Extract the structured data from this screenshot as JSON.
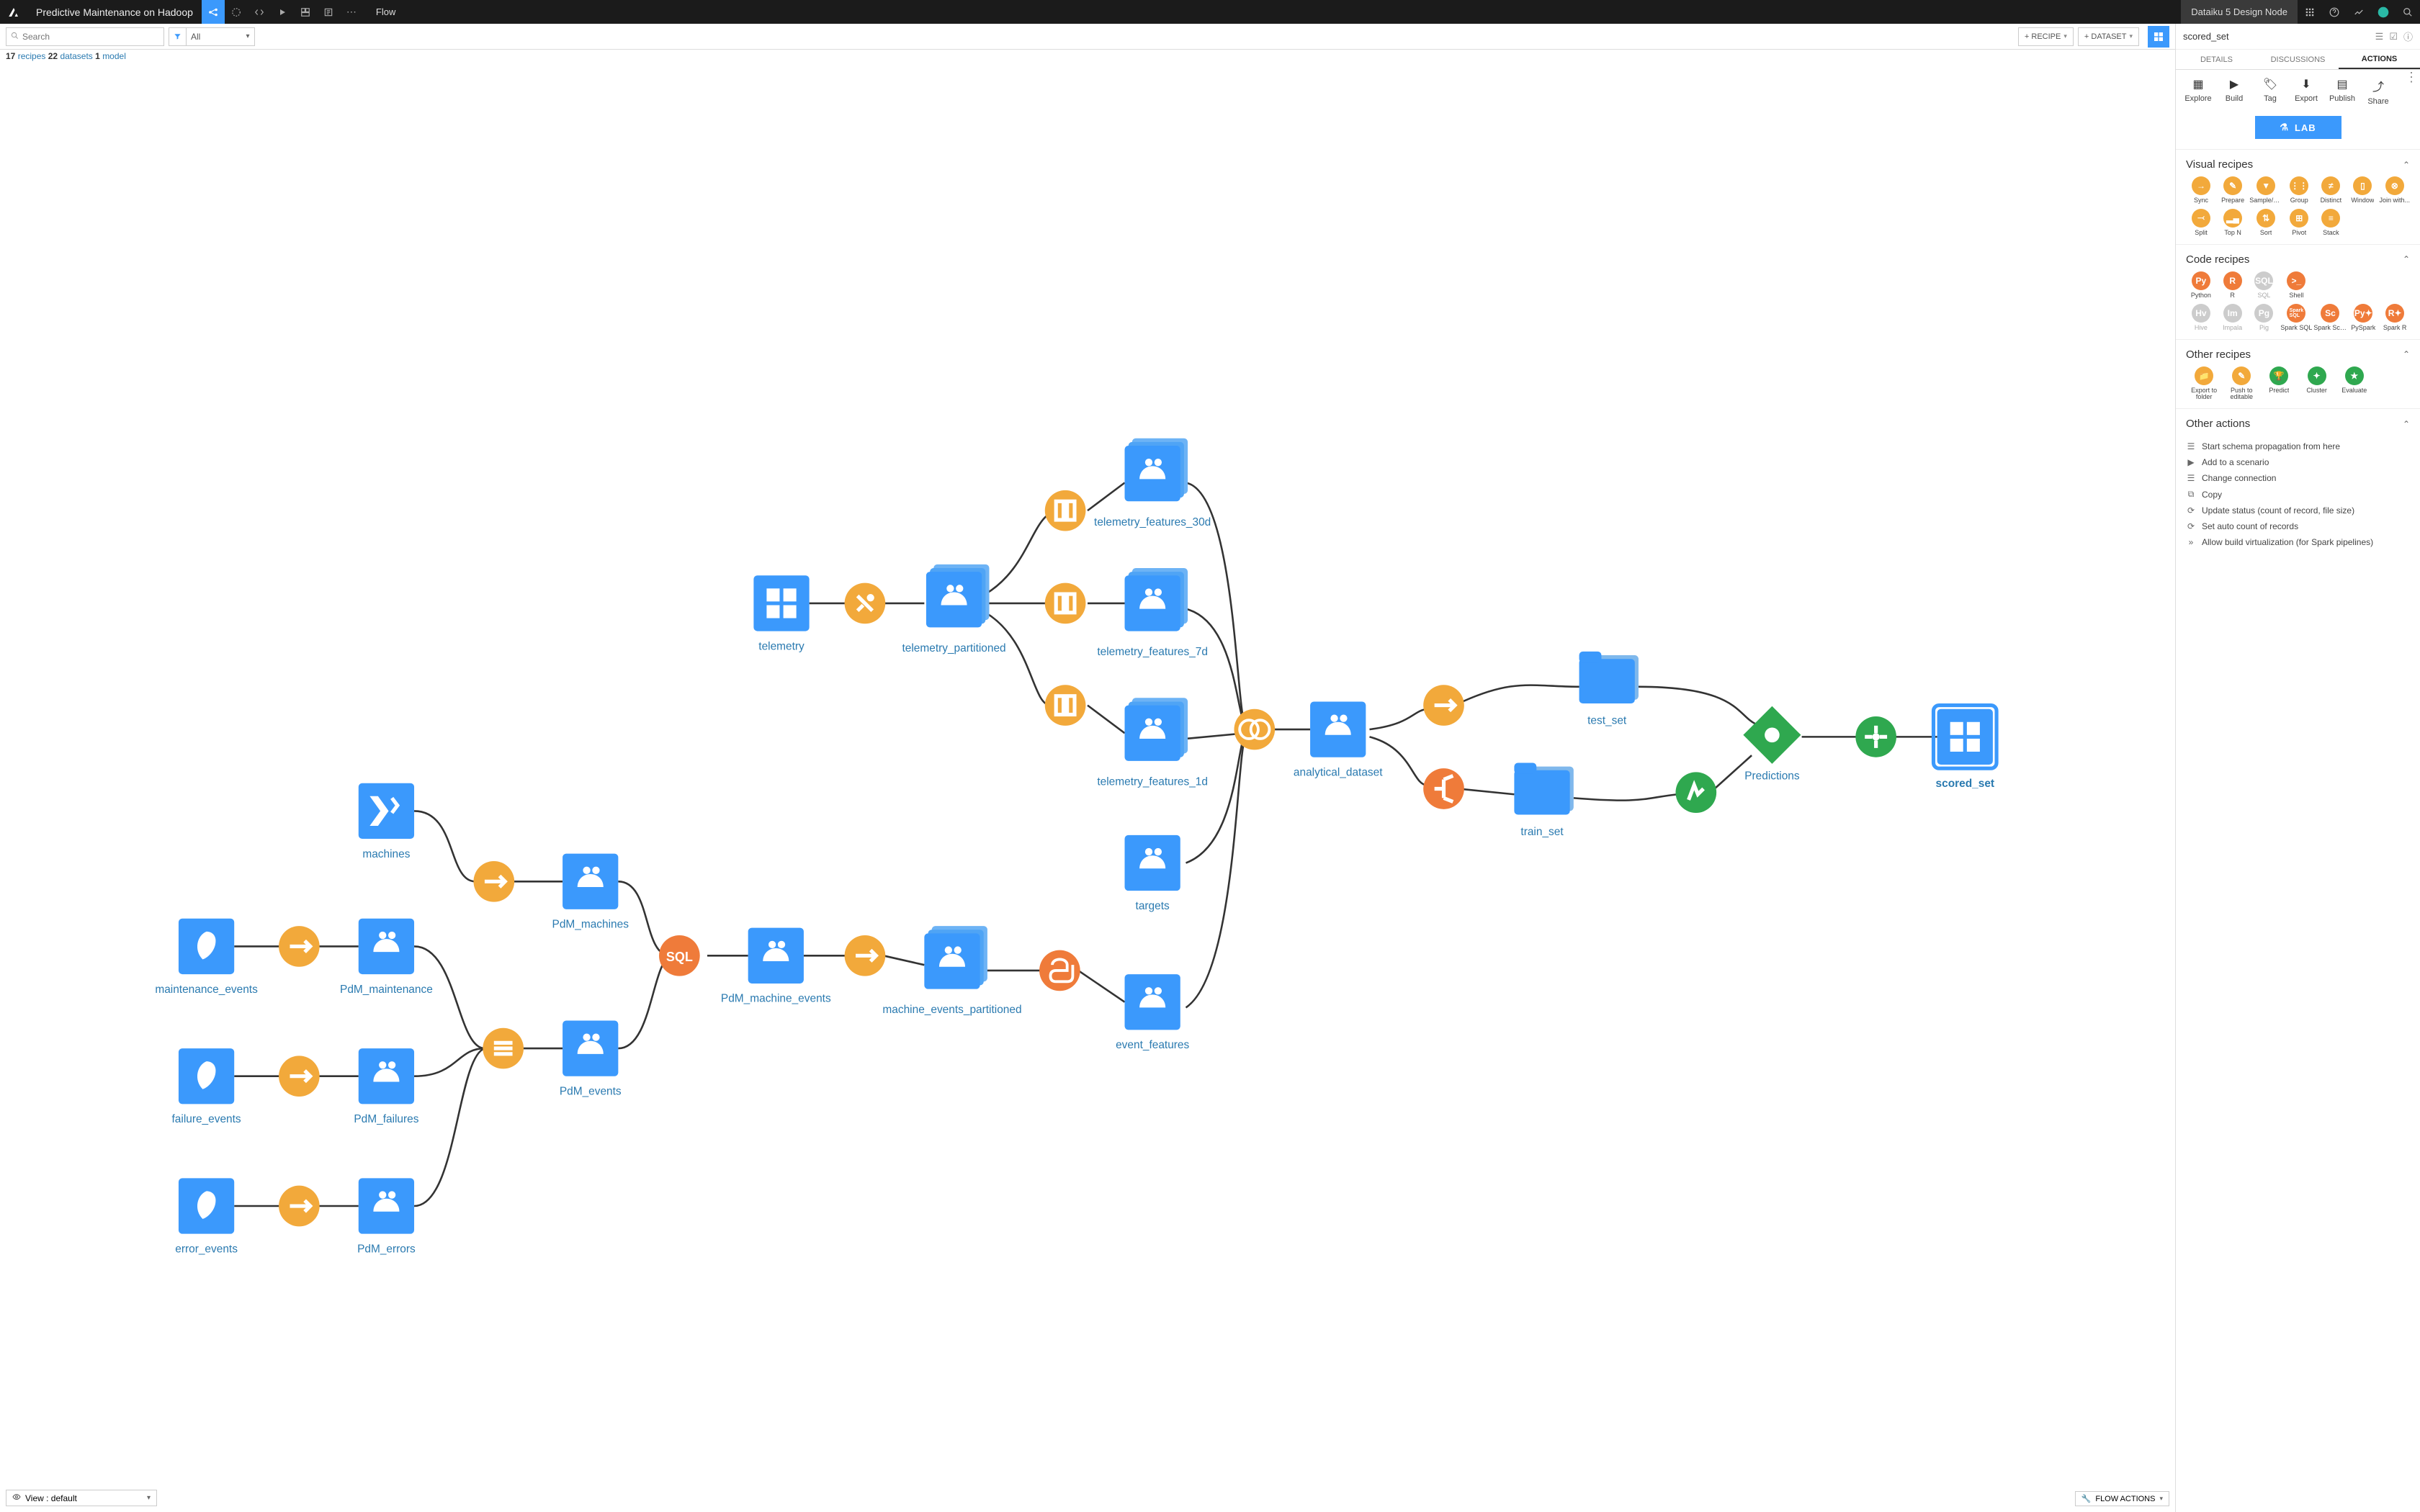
{
  "topbar": {
    "project_title": "Predictive Maintenance on Hadoop",
    "flow_label": "Flow",
    "node_name": "Dataiku 5 Design Node"
  },
  "subbar": {
    "search_placeholder": "Search",
    "filter_label": "All",
    "recipe_btn": "+ RECIPE",
    "dataset_btn": "+ DATASET"
  },
  "counts": {
    "recipes_n": "17",
    "recipes_l": "recipes",
    "datasets_n": "22",
    "datasets_l": "datasets",
    "models_n": "1",
    "models_l": "model"
  },
  "bottom": {
    "view_label": "View : default",
    "flow_actions": "FLOW ACTIONS"
  },
  "sidepanel": {
    "selected": "scored_set",
    "tabs": {
      "details": "DETAILS",
      "discussions": "DISCUSSIONS",
      "actions": "ACTIONS"
    },
    "actions": {
      "explore": "Explore",
      "build": "Build",
      "tag": "Tag",
      "export": "Export",
      "publish": "Publish",
      "share": "Share"
    },
    "lab": "LAB",
    "sections": {
      "visual": "Visual recipes",
      "code": "Code recipes",
      "other_recipes": "Other recipes",
      "other_actions": "Other actions"
    },
    "visual": {
      "sync": "Sync",
      "prepare": "Prepare",
      "sample": "Sample/Filter",
      "group": "Group",
      "distinct": "Distinct",
      "window": "Window",
      "join": "Join with...",
      "split": "Split",
      "topn": "Top N",
      "sort": "Sort",
      "pivot": "Pivot",
      "stack": "Stack"
    },
    "code": {
      "python": "Python",
      "r": "R",
      "sql": "SQL",
      "shell": "Shell",
      "hive": "Hive",
      "impala": "Impala",
      "pig": "Pig",
      "sparksql": "Spark SQL",
      "sparkscala": "Spark Scala",
      "pyspark": "PySpark",
      "sparkr": "Spark R"
    },
    "orecipes": {
      "export_folder": "Export to folder",
      "push_editable": "Push to editable",
      "predict": "Predict",
      "cluster": "Cluster",
      "evaluate": "Evaluate"
    },
    "oactions": {
      "schema": "Start schema propagation from here",
      "scenario": "Add to a scenario",
      "change_conn": "Change connection",
      "copy": "Copy",
      "update_status": "Update status (count of record, file size)",
      "auto_count": "Set auto count of records",
      "build_virt": "Allow build virtualization (for Spark pipelines)"
    }
  },
  "flow_nodes": {
    "telemetry": "telemetry",
    "machines": "machines",
    "maintenance_events": "maintenance_events",
    "failure_events": "failure_events",
    "error_events": "error_events",
    "pdm_machines": "PdM_machines",
    "pdm_maintenance": "PdM_maintenance",
    "pdm_failures": "PdM_failures",
    "pdm_errors": "PdM_errors",
    "pdm_events": "PdM_events",
    "pdm_machine_events": "PdM_machine_events",
    "telemetry_partitioned": "telemetry_partitioned",
    "machine_events_partitioned": "machine_events_partitioned",
    "telemetry_features_30d": "telemetry_features_30d",
    "telemetry_features_7d": "telemetry_features_7d",
    "telemetry_features_1d": "telemetry_features_1d",
    "targets": "targets",
    "event_features": "event_features",
    "analytical_dataset": "analytical_dataset",
    "test_set": "test_set",
    "train_set": "train_set",
    "predictions": "Predictions",
    "scored_set": "scored_set"
  }
}
